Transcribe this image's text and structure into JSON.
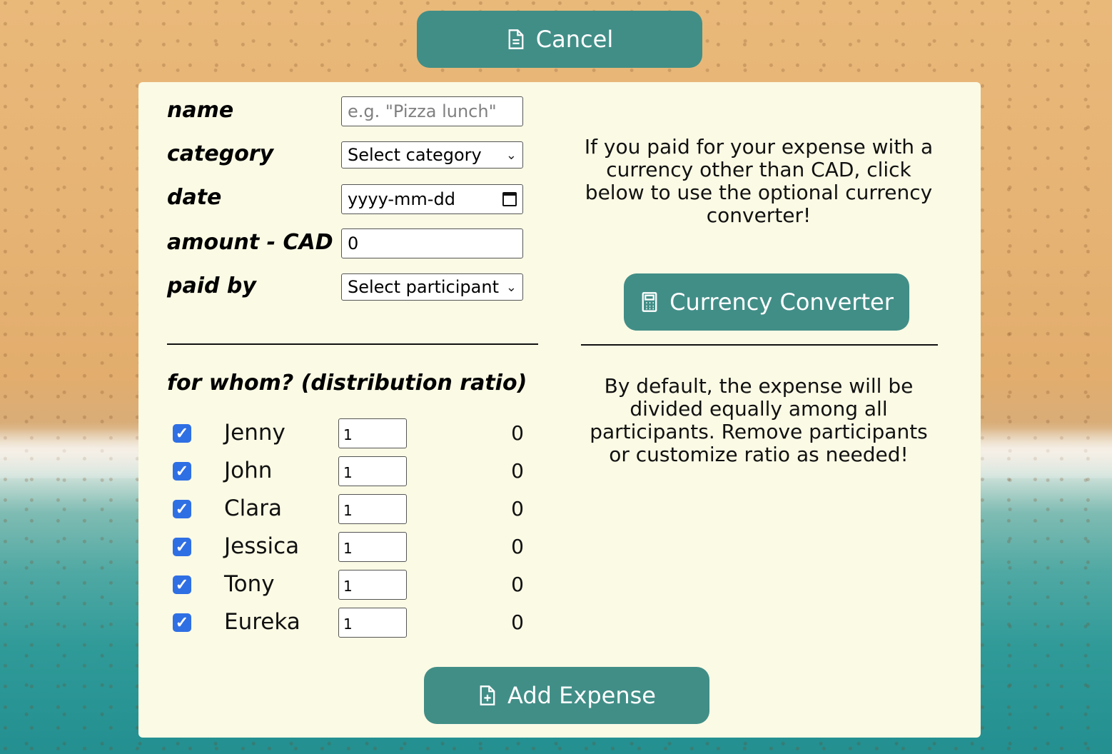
{
  "buttons": {
    "cancel": "Cancel",
    "currency_converter": "Currency Converter",
    "add_expense": "Add Expense"
  },
  "form": {
    "name_label": "name",
    "name_placeholder": "e.g. \"Pizza lunch\"",
    "category_label": "category",
    "category_selected": "Select category",
    "date_label": "date",
    "date_placeholder": "yyyy-mm-dd",
    "amount_label": "amount - CAD",
    "amount_value": "0",
    "paid_by_label": "paid by",
    "paid_by_selected": "Select participant"
  },
  "info": {
    "currency_text": "If you paid for your expense with a currency other than CAD, click below to use the optional currency converter!",
    "distribution_text": "By default, the expense will be divided equally among all participants. Remove participants or customize ratio as needed!"
  },
  "distribution": {
    "heading": "for whom? (distribution ratio)",
    "participants": [
      {
        "name": "Jenny",
        "ratio": "1",
        "share": "0",
        "checked": true
      },
      {
        "name": "John",
        "ratio": "1",
        "share": "0",
        "checked": true
      },
      {
        "name": "Clara",
        "ratio": "1",
        "share": "0",
        "checked": true
      },
      {
        "name": "Jessica",
        "ratio": "1",
        "share": "0",
        "checked": true
      },
      {
        "name": "Tony",
        "ratio": "1",
        "share": "0",
        "checked": true
      },
      {
        "name": "Eureka",
        "ratio": "1",
        "share": "0",
        "checked": true
      }
    ]
  },
  "icons": {
    "cancel": "file-icon",
    "converter": "calculator-icon",
    "add": "file-plus-icon"
  },
  "colors": {
    "button": "#418e87",
    "panel": "#fbfae5",
    "checkbox": "#2f6fe4"
  }
}
